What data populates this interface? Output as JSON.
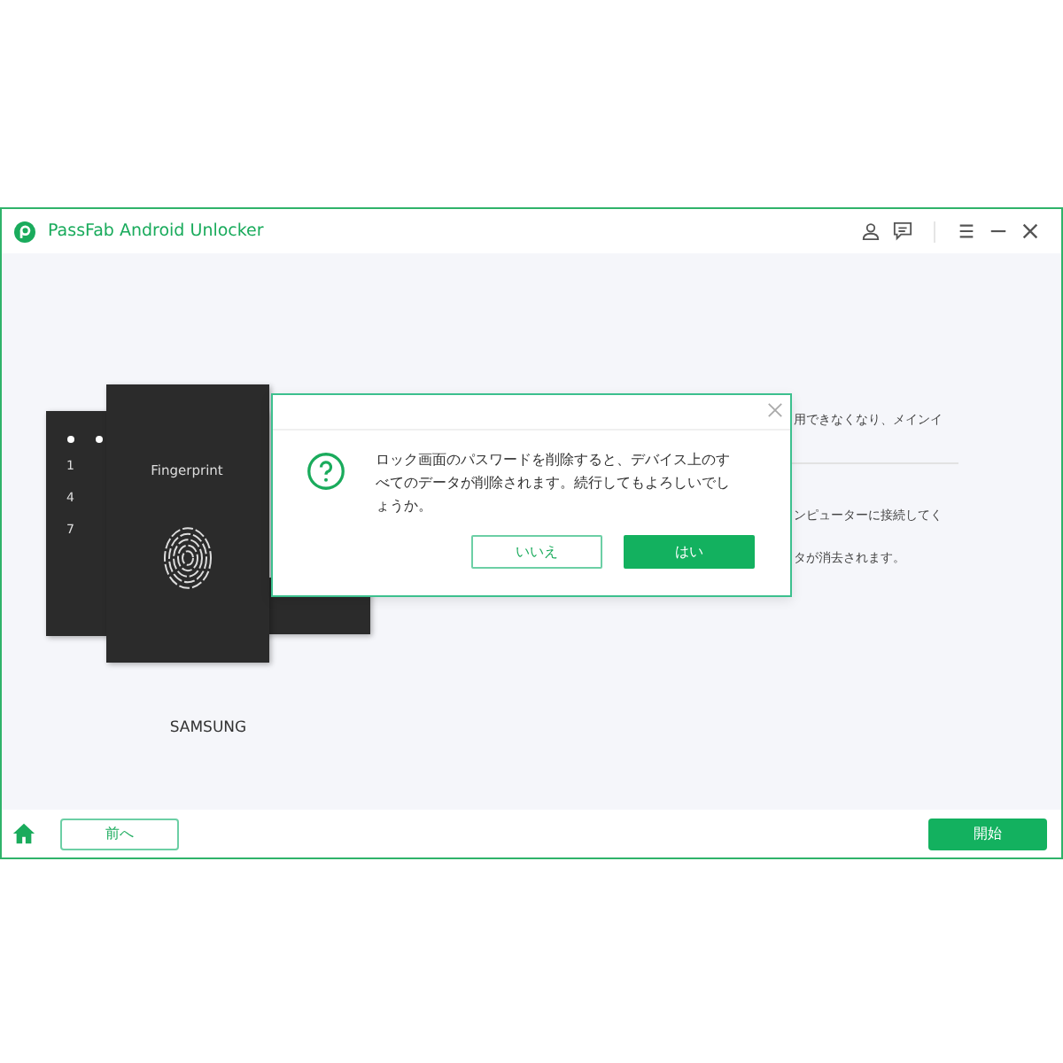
{
  "window": {
    "title": "PassFab Android Unlocker"
  },
  "content": {
    "lines": [
      "用できなくなり、メインイ",
      "ンピューターに接続してく",
      "タが消去されます。"
    ],
    "phone": {
      "pin_keys": [
        "1",
        "4",
        "7"
      ],
      "fingerprint_label": "Fingerprint",
      "brand": "SAMSUNG"
    }
  },
  "dialog": {
    "message": "ロック画面のパスワードを削除すると、デバイス上のすべてのデータが削除されます。続行してもよろしいでしょうか。",
    "buttons": [
      {
        "label": "いいえ",
        "kind": "secondary"
      },
      {
        "label": "はい",
        "kind": "primary"
      }
    ]
  },
  "footer": {
    "back": "前へ",
    "start": "開始"
  }
}
